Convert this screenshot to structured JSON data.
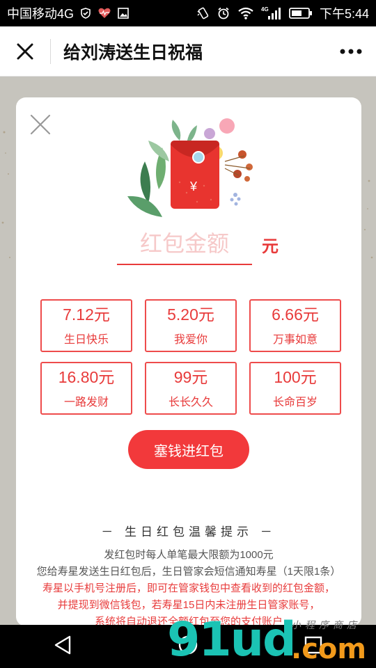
{
  "status_bar": {
    "carrier": "中国移动4G",
    "time": "下午5:44",
    "network": "4G"
  },
  "nav": {
    "title": "给刘涛送生日祝福"
  },
  "envelope": {
    "symbol": "¥"
  },
  "amount": {
    "placeholder": "红包金额",
    "unit": "元"
  },
  "options": [
    {
      "amount": "7.12元",
      "wish": "生日快乐"
    },
    {
      "amount": "5.20元",
      "wish": "我爱你"
    },
    {
      "amount": "6.66元",
      "wish": "万事如意"
    },
    {
      "amount": "16.80元",
      "wish": "一路发财"
    },
    {
      "amount": "99元",
      "wish": "长长久久"
    },
    {
      "amount": "100元",
      "wish": "长命百岁"
    }
  ],
  "submit_label": "塞钱进红包",
  "tips": {
    "title": "－ 生日红包温馨提示 －",
    "line1": "发红包时每人单笔最大限额为1000元",
    "line2": "您给寿星发送生日红包后，生日管家会短信通知寿星（1天限1条）",
    "line3": "寿星以手机号注册后，即可在管家钱包中查看收到的红包金额，",
    "line4": "并提现到微信钱包，若寿星15日内未注册生日管家账号，",
    "line5": "系统将自动退还全额红包至您的支付账户"
  },
  "watermark": {
    "main": "91ud",
    "suffix": ".com",
    "sub": "小程序商店"
  },
  "colors": {
    "accent": "#f2393b",
    "accent_text": "#e83b3b",
    "placeholder": "#f6c9c9",
    "backdrop": "#c6c4bd"
  }
}
